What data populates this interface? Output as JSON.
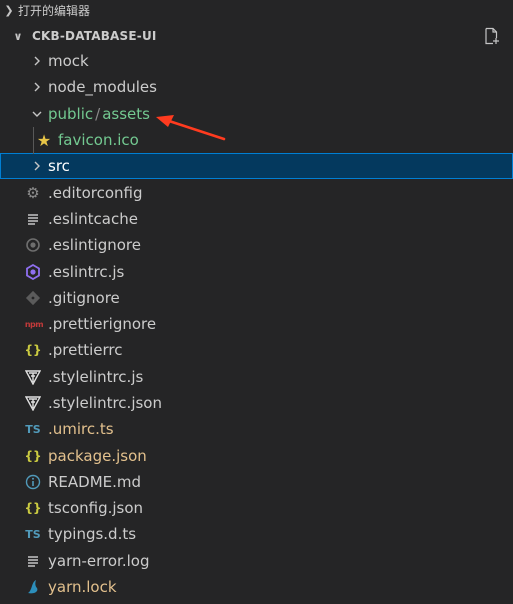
{
  "open_editors": {
    "label": "打开的编辑器"
  },
  "workspace": {
    "title": "CKB-DATABASE-UI"
  },
  "tree": {
    "mock": "mock",
    "node_modules": "node_modules",
    "public_assets": {
      "part1": "public",
      "sep": "/",
      "part2": "assets"
    },
    "favicon": "favicon.ico",
    "src": "src",
    "editorconfig": ".editorconfig",
    "eslintcache": ".eslintcache",
    "eslintignore": ".eslintignore",
    "eslintrc": ".eslintrc.js",
    "gitignore": ".gitignore",
    "prettierignore": ".prettierignore",
    "prettierrc": ".prettierrc",
    "stylelintrc_js": ".stylelintrc.js",
    "stylelintrc_json": ".stylelintrc.json",
    "umirc": ".umirc.ts",
    "package": "package.json",
    "readme": "README.md",
    "tsconfig": "tsconfig.json",
    "typings": "typings.d.ts",
    "yarn_error": "yarn-error.log",
    "yarn_lock": "yarn.lock"
  },
  "icons": {
    "braces": "{}",
    "ts": "TS",
    "info": "i",
    "npm": "npm"
  },
  "colors": {
    "accent_selected": "#04395e",
    "modified_green": "#73c991",
    "modified_yellow": "#e2c08d",
    "arrow_red": "#ff3b1f"
  }
}
